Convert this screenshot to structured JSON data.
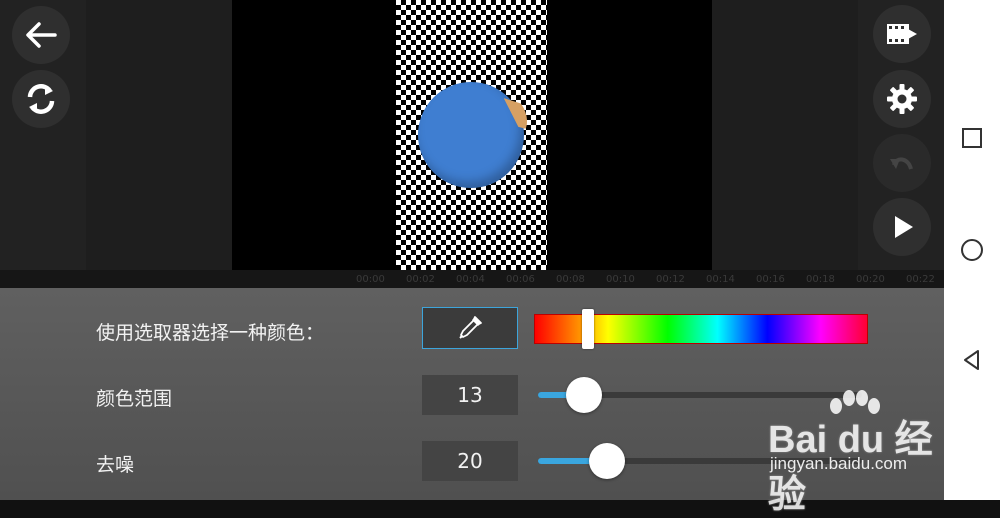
{
  "toolbar": {
    "back_icon": "arrow-left-icon",
    "sync_icon": "refresh-icon",
    "export_icon": "film-export-icon",
    "settings_icon": "gear-icon",
    "undo_icon": "undo-icon",
    "play_icon": "play-icon"
  },
  "timeline": {
    "ticks": [
      "00:00",
      "00:02",
      "00:04",
      "00:06",
      "00:08",
      "00:10",
      "00:12",
      "00:14",
      "00:16",
      "00:18",
      "00:20",
      "00:22"
    ]
  },
  "panel": {
    "picker_label": "使用选取器选择一种颜色：",
    "picker_icon": "eyedropper-icon",
    "hue_position": 0.16,
    "range_label": "颜色范围",
    "range_value": "13",
    "range_fraction": 0.13,
    "noise_label": "去噪",
    "noise_value": "20",
    "noise_fraction": 0.2
  },
  "navigation": {
    "recents_icon": "square-icon",
    "home_icon": "circle-icon",
    "back_icon": "triangle-back-icon"
  },
  "watermark": {
    "brand": "Bai du 经验",
    "url": "jingyan.baidu.com"
  },
  "colors": {
    "accent": "#3aa6df",
    "panel_bg": "#5a5a5a",
    "subject": "#3f7ed1"
  }
}
